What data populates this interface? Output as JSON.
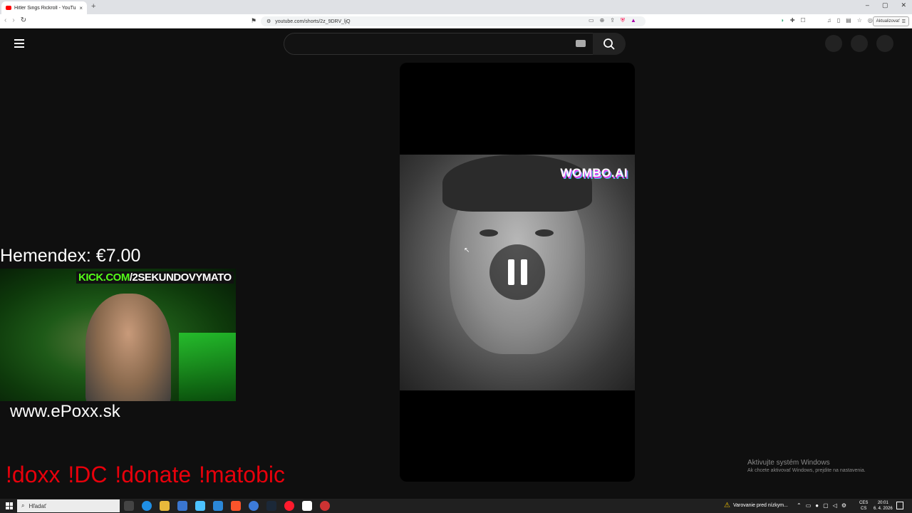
{
  "browser": {
    "tab_title": "Hitler Sings Rickroll - YouTube",
    "tab_close": "×",
    "new_tab": "+",
    "url": "youtube.com/shorts/2z_9DRV_ljQ",
    "update_label": "Aktualizovať",
    "window_controls": [
      "–",
      "▢",
      "✕"
    ]
  },
  "video": {
    "watermark_text": "WOMBO.AI",
    "state": "paused"
  },
  "stream_overlay": {
    "donation": "Hemendex: €7.00",
    "kick_prefix": "KICK.COM",
    "kick_suffix": "/2SEKUNDOVYMATO",
    "website": "www.ePoxx.sk",
    "commands": "!doxx  !DC !donate !matobic"
  },
  "windows_activation": {
    "title": "Aktivujte systém Windows",
    "subtitle": "Ak chcete aktivovať Windows, prejdite na nastavenia."
  },
  "taskbar": {
    "search_placeholder": "Hľadať",
    "warning_text": "Varovanie pred nízkym...",
    "lang_top": "CES",
    "lang_bottom": "CS",
    "time": "20:01",
    "date": "6. 4. 2026"
  },
  "colors": {
    "accent_red": "#e8000b",
    "kick_green": "#53fc18",
    "youtube_red": "#ff0000"
  }
}
